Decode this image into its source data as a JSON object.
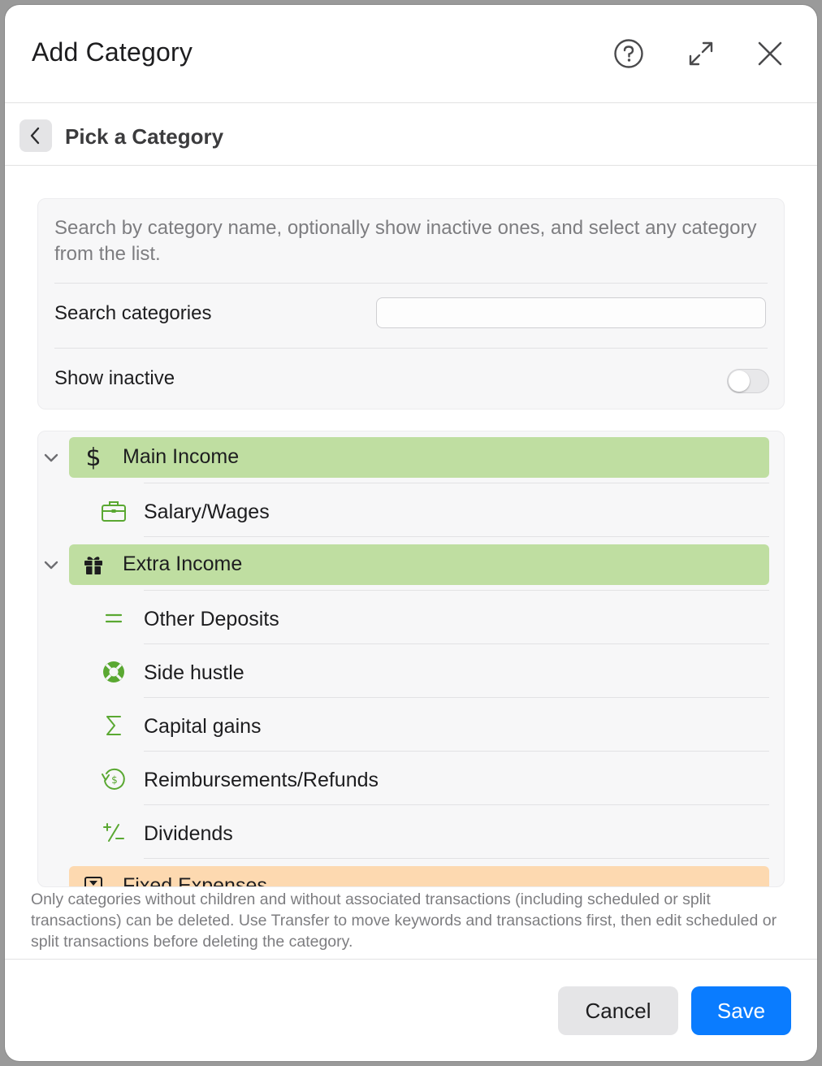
{
  "window": {
    "title": "Add Category",
    "icons": [
      "help-icon",
      "expand-icon",
      "close-icon"
    ]
  },
  "subheader": {
    "back_icon": "chevron-left-icon",
    "title": "Pick a Category"
  },
  "search_card": {
    "description": "Search by category name, optionally show inactive ones, and select any category from the list.",
    "search_label": "Search categories",
    "search_value": "",
    "search_placeholder": "",
    "inactive_label": "Show inactive",
    "show_inactive": false
  },
  "categories": [
    {
      "label": "Main Income",
      "icon": "dollar-icon",
      "color": "#bfdea1",
      "expanded": true,
      "children": [
        {
          "label": "Salary/Wages",
          "icon": "briefcase-icon"
        }
      ]
    },
    {
      "label": "Extra Income",
      "icon": "gift-icon",
      "color": "#bfdea1",
      "expanded": true,
      "children": [
        {
          "label": "Other Deposits",
          "icon": "equals-icon"
        },
        {
          "label": "Side hustle",
          "icon": "lifebuoy-icon"
        },
        {
          "label": "Capital gains",
          "icon": "sigma-icon"
        },
        {
          "label": "Reimbursements/Refunds",
          "icon": "refund-icon"
        },
        {
          "label": "Dividends",
          "icon": "plus-minus-icon"
        }
      ]
    },
    {
      "label": "Fixed Expenses",
      "icon": "hourglass-icon",
      "color": "#fdd9b0",
      "expanded": false,
      "children": []
    }
  ],
  "footer_note": "Only categories without children and without associated transactions (including scheduled or split transactions) can be deleted. Use Transfer to move keywords and transactions first, then edit scheduled or split transactions before deleting the category.",
  "buttons": {
    "cancel": "Cancel",
    "save": "Save"
  },
  "colors": {
    "accent": "#0a7cff",
    "icon_green": "#5aa832",
    "income_group": "#bfdea1",
    "expense_group": "#fdd9b0"
  }
}
